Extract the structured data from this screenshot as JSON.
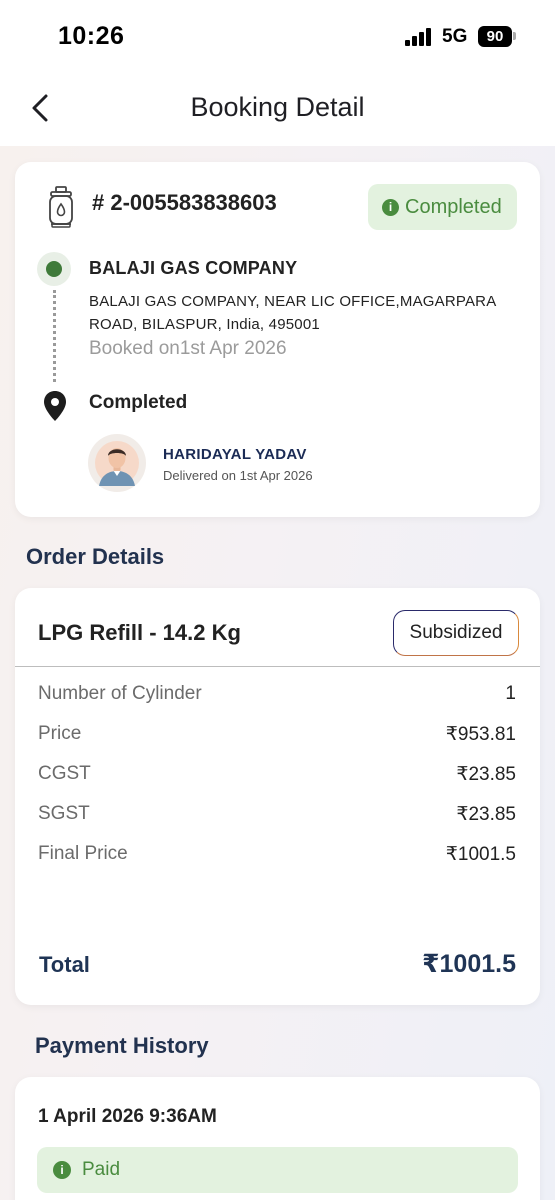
{
  "status_bar": {
    "time": "10:26",
    "network": "5G",
    "battery": "90"
  },
  "header": {
    "title": "Booking Detail",
    "back_icon": "chevron-left-icon"
  },
  "booking": {
    "id": "# 2-005583838603",
    "status": "Completed",
    "status_color": "#4a8c3f",
    "status_bg": "#e3f2df",
    "distributor_name": "BALAJI GAS COMPANY",
    "distributor_address": "BALAJI GAS COMPANY, NEAR LIC OFFICE,MAGARPARA ROAD, BILASPUR, India, 495001",
    "booked_on": "Booked on1st Apr 2026",
    "delivery_status": "Completed",
    "agent_name": "HARIDAYAL YADAV",
    "delivered_on": "Delivered on 1st Apr 2026"
  },
  "order_details": {
    "section_title": "Order Details",
    "product": "LPG Refill - 14.2 Kg",
    "type_badge": "Subsidized",
    "rows": [
      {
        "label": "Number of Cylinder",
        "value": "1"
      },
      {
        "label": "Price",
        "value": "₹953.81"
      },
      {
        "label": "CGST",
        "value": "₹23.85"
      },
      {
        "label": "SGST",
        "value": "₹23.85"
      },
      {
        "label": "Final Price",
        "value": "₹1001.5"
      }
    ],
    "total_label": "Total",
    "total_value": "₹1001.5"
  },
  "payment_history": {
    "section_title": "Payment History",
    "date": "1 April 2026 9:36AM",
    "status": "Paid"
  },
  "colors": {
    "accent_navy": "#1f3455",
    "success_green": "#4a8c3f"
  }
}
